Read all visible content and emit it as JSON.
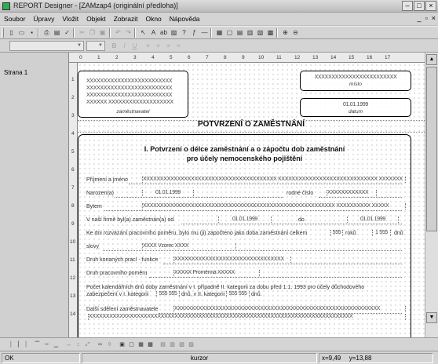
{
  "window": {
    "title": "REPORT Designer - [ZAMzap4 (originální předloha)]"
  },
  "menu": [
    "Soubor",
    "Úpravy",
    "Vložit",
    "Objekt",
    "Zobrazit",
    "Okno",
    "Nápověda"
  ],
  "left_panel": {
    "page_label": "Strana 1"
  },
  "ruler": {
    "h_ticks": [
      "0",
      "1",
      "2",
      "3",
      "4",
      "5",
      "6",
      "7",
      "8",
      "9",
      "10",
      "11",
      "12",
      "13",
      "14",
      "15",
      "16",
      "17"
    ],
    "v_ticks": [
      "1",
      "2",
      "3",
      "4",
      "5",
      "6",
      "7",
      "8",
      "9",
      "10",
      "11",
      "12",
      "13",
      "14"
    ]
  },
  "form": {
    "employer_box": {
      "lines": [
        "XXXXXXXXXXXXXXXXXXXXXXXXX",
        "XXXXXXXXXXXXXXXXXXXXXXXXX",
        "XXXXXXXXXXXXXXXXXXXXXXXXX",
        "XXXXXX XXXXXXXXXXXXXXXXXXX"
      ],
      "caption": "zaměstnavatel"
    },
    "place_box": {
      "value": "XXXXXXXXXXXXXXXXXXXXXXXX",
      "caption": "místo"
    },
    "date_box": {
      "value": "01.01.1999",
      "caption": "datum"
    },
    "heading": "POTVRZENÍ O ZAMĚSTNÁNÍ",
    "section_title_1": "I. Potvrzení o délce zaměstnání a o zápočtu dob zaměstnání",
    "section_title_2": "pro účely nemocenského pojištění",
    "rows": {
      "name_label": "Příjmení a jméno",
      "name_value": "XXXXXXXXXXXXXXXXXXXXXXXXXXXXXXXXXXXXXXX XXXXXXXXXXXXXXXXXXXXXXXXXXXXX XXXXXXX",
      "born_label": "Narozen(a)",
      "born_value": "01.01.1999",
      "rc_label": "rodné číslo",
      "rc_value": "XXXXXXXXXXXX",
      "address_label": "Bytem",
      "address_value": "XXXXXXXXXXXXXXXXXXXXXXXXXXXXXXXXXXXXXXXXXXXXXXXXXXXXXXXX XXXXXXXXXX XXXXX",
      "employment_label": "V naší firmě byl(a) zaměstnán(a) od",
      "employment_from": "01.01.1999",
      "employment_to_label": "do",
      "employment_to": "01.01.1999",
      "total_label": "Ke dni rozvázání pracovního poměru, bylo mu (ji) započteno jako doba zaměstnání celkem",
      "total_years": "555",
      "years_label": "roků",
      "total_days": "1 555",
      "days_label": "dnů",
      "words_label": "slovy",
      "words_value": "XXXX Vzorec XXXX",
      "work_type_label": "Druh konaných prací - funkce",
      "work_type_value": "XXXXXXXXXXXXXXXXXXXXXXXXXXXXXXXX",
      "contract_label": "Druh pracovního poměru",
      "contract_value": "XXXXX Proměnná XXXXX",
      "days_count_line1": "Počet kalendářních dnů doby zaměstnání v I. případně II. kategorii za dobu před 1.1. 1993 pro účely důchodového",
      "days_count_line2a": "zabezpečení v I. kategorii",
      "days_cat1": "555 555",
      "days_count_line2b": "dnů, v II. kategorii",
      "days_cat2": "555 555",
      "days_count_line2c": "dnů.",
      "other_label": "Další sdělení zaměstnavatele",
      "other_value_1": "XXXXXXXXXXXXXXXXXXXXXXXXXXXXXXXXXXXXXXXXXXXXXXXXXXXXXXXXXXXX",
      "other_value_2": "XXXXXXXXXXXXXXXXXXXXXXXXXXXXXXXXXXXXXXXXXXXXXXXXXXXXXXXXXXXXXXXXXXXXXXXXXXXXX"
    }
  },
  "status": {
    "left": "OK",
    "middle": "kurzor",
    "x_label": "x=9,49",
    "y_label": "y=13,88"
  }
}
